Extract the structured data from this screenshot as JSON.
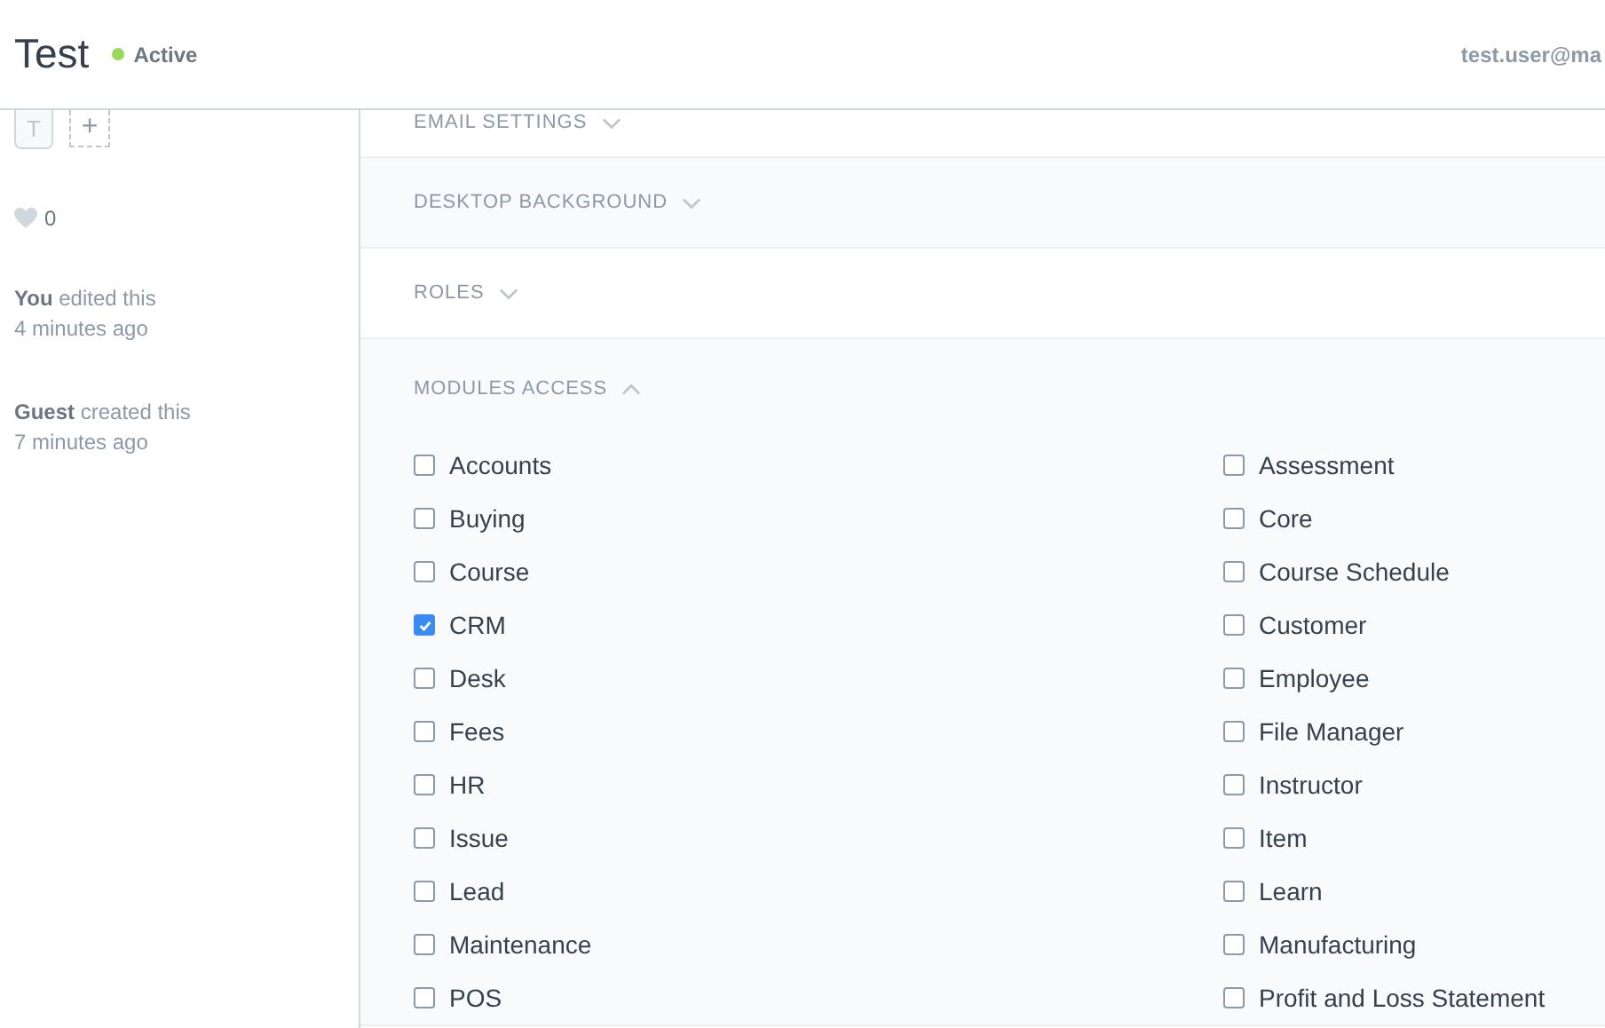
{
  "header": {
    "title": "Test",
    "status": {
      "label": "Active",
      "color": "#98d85b"
    },
    "user": "test.user@ma"
  },
  "sidebar": {
    "assign": {
      "initial": "T",
      "add": "+"
    },
    "likes": "0",
    "activity": [
      {
        "who": "You",
        "text": "edited this",
        "time": "4 minutes ago"
      },
      {
        "who": "Guest",
        "text": "created this",
        "time": "7 minutes ago"
      }
    ]
  },
  "sections": [
    {
      "label": "EMAIL SETTINGS",
      "expanded": false
    },
    {
      "label": "DESKTOP BACKGROUND",
      "expanded": false
    },
    {
      "label": "ROLES",
      "expanded": false
    },
    {
      "label": "MODULES ACCESS",
      "expanded": true
    }
  ],
  "modules": [
    {
      "label": "Accounts",
      "checked": false
    },
    {
      "label": "Assessment",
      "checked": false
    },
    {
      "label": "Buying",
      "checked": false
    },
    {
      "label": "Core",
      "checked": false
    },
    {
      "label": "Course",
      "checked": false
    },
    {
      "label": "Course Schedule",
      "checked": false
    },
    {
      "label": "CRM",
      "checked": true
    },
    {
      "label": "Customer",
      "checked": false
    },
    {
      "label": "Desk",
      "checked": false
    },
    {
      "label": "Employee",
      "checked": false
    },
    {
      "label": "Fees",
      "checked": false
    },
    {
      "label": "File Manager",
      "checked": false
    },
    {
      "label": "HR",
      "checked": false
    },
    {
      "label": "Instructor",
      "checked": false
    },
    {
      "label": "Issue",
      "checked": false
    },
    {
      "label": "Item",
      "checked": false
    },
    {
      "label": "Lead",
      "checked": false
    },
    {
      "label": "Learn",
      "checked": false
    },
    {
      "label": "Maintenance",
      "checked": false
    },
    {
      "label": "Manufacturing",
      "checked": false
    },
    {
      "label": "POS",
      "checked": false
    },
    {
      "label": "Profit and Loss Statement",
      "checked": false
    }
  ]
}
